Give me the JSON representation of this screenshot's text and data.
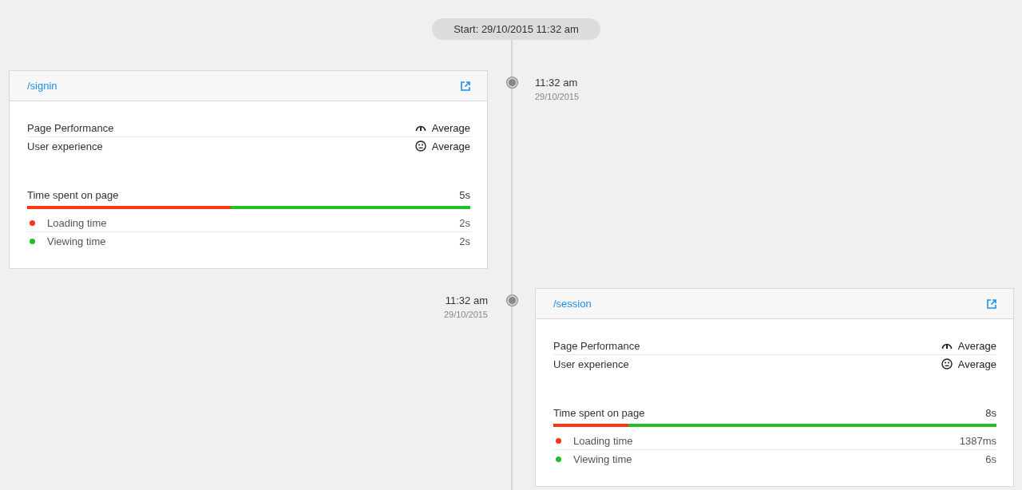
{
  "start_label": "Start: 29/10/2015 11:32 am",
  "entries": [
    {
      "kind": "left",
      "time": "11:32 am",
      "date": "29/10/2015",
      "path": "/signin",
      "metrics": [
        {
          "kind": "performance",
          "label": "Page Performance",
          "value": "Average"
        },
        {
          "kind": "experience",
          "label": "User experience",
          "value": "Average"
        }
      ],
      "time_label": "Time spent on page",
      "total": "5s",
      "segments": [
        {
          "label": "Loading time",
          "value": "2s",
          "color": "#ff3516",
          "level": 0.46
        },
        {
          "label": "Viewing time",
          "value": "2s",
          "color": "#1fc12a"
        }
      ]
    },
    {
      "kind": "right",
      "time": "11:32 am",
      "date": "29/10/2015",
      "path": "/session",
      "metrics": [
        {
          "kind": "performance",
          "label": "Page Performance",
          "value": "Average"
        },
        {
          "kind": "experience",
          "label": "User experience",
          "value": "Average"
        }
      ],
      "time_label": "Time spent on page",
      "total": "8s",
      "segments": [
        {
          "label": "Loading time",
          "value": "1387ms",
          "color": "#ff3516",
          "level": 0.17
        },
        {
          "label": "Viewing time",
          "value": "6s",
          "color": "#1fc12a"
        }
      ]
    }
  ]
}
